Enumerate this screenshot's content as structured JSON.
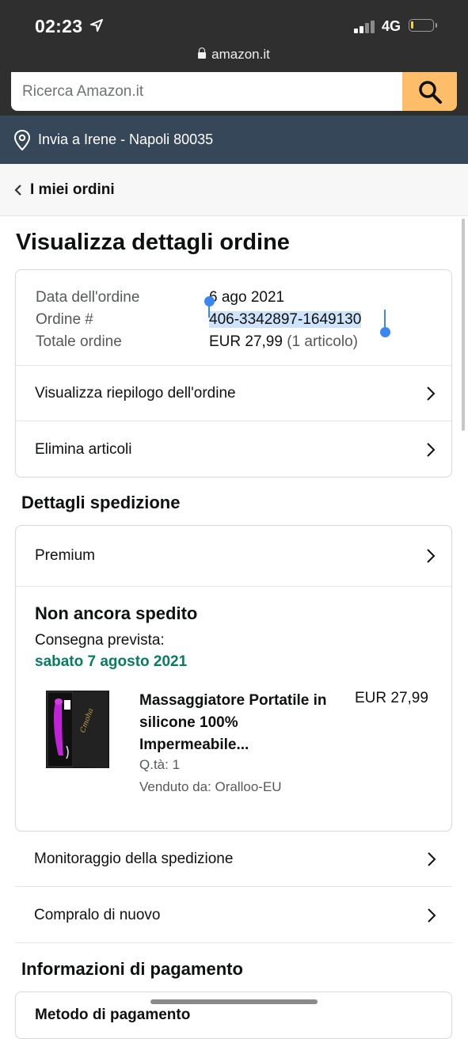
{
  "status_bar": {
    "time": "02:23",
    "network": "4G",
    "url": "amazon.it"
  },
  "search": {
    "placeholder": "Ricerca Amazon.it"
  },
  "deliver": {
    "text": "Invia a Irene - Napoli 80035"
  },
  "nav": {
    "back_label": "I miei ordini"
  },
  "page": {
    "title": "Visualizza dettagli ordine"
  },
  "summary": {
    "date_label": "Data dell'ordine",
    "date_value": "6 ago 2021",
    "order_label": "Ordine #",
    "order_value": "406-3342897-1649130",
    "total_label": "Totale ordine",
    "total_value": "EUR 27,99",
    "total_items": "(1 articolo)",
    "view_summary": "Visualizza riepilogo dell'ordine",
    "delete_items": "Elimina articoli"
  },
  "shipping": {
    "section_title": "Dettagli spedizione",
    "method": "Premium",
    "status": "Non ancora spedito",
    "delivery_label": "Consegna prevista:",
    "delivery_date": "sabato 7 agosto 2021",
    "colors": {
      "delivery_date": "#067d62"
    },
    "product": {
      "title": "Massaggiatore Portatile in silicone 100% Impermeabile...",
      "price": "EUR 27,99",
      "qty": "Q.tà: 1",
      "seller": "Venduto da: Oralloo-EU"
    },
    "track": "Monitoraggio della spedizione",
    "buy_again": "Compralo di nuovo"
  },
  "payment": {
    "section_title": "Informazioni di pagamento",
    "first_row": "Metodo di pagamento"
  },
  "accent": {
    "search_button": "#febd69",
    "deliver_bar": "#37475a",
    "selection": "#3b87f0"
  }
}
